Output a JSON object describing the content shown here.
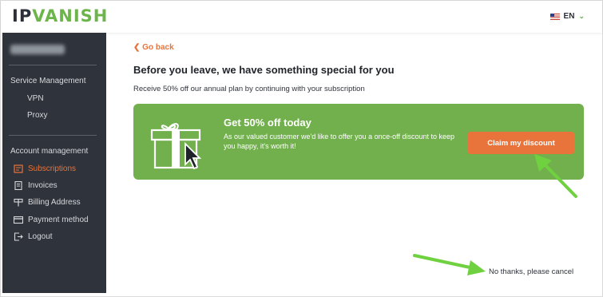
{
  "header": {
    "logo_part1": "IP",
    "logo_part2": "VANISH",
    "language": "EN"
  },
  "sidebar": {
    "section1_label": "Service Management",
    "section1_items": [
      {
        "label": "VPN"
      },
      {
        "label": "Proxy"
      }
    ],
    "section2_label": "Account management",
    "section2_items": [
      {
        "label": "Subscriptions",
        "icon": "subscriptions-icon",
        "active": true
      },
      {
        "label": "Invoices",
        "icon": "invoices-icon"
      },
      {
        "label": "Billing Address",
        "icon": "billing-address-icon"
      },
      {
        "label": "Payment method",
        "icon": "credit-card-icon"
      },
      {
        "label": "Logout",
        "icon": "logout-icon"
      }
    ]
  },
  "main": {
    "go_back": "Go back",
    "title": "Before you leave, we have something special for you",
    "subtitle": "Receive 50% off our annual plan by continuing with your subscription",
    "offer": {
      "title": "Get 50% off today",
      "text": "As our valued customer we'd like to offer you a once-off discount to keep you happy, it's worth it!",
      "button": "Claim my discount"
    },
    "cancel_link": "No thanks, please cancel"
  },
  "colors": {
    "accent": "#e8743b",
    "brand_green": "#6bb54a",
    "banner_green": "#72b04e",
    "sidebar_bg": "#2f333b",
    "annotation_arrow": "#6fd13f"
  }
}
